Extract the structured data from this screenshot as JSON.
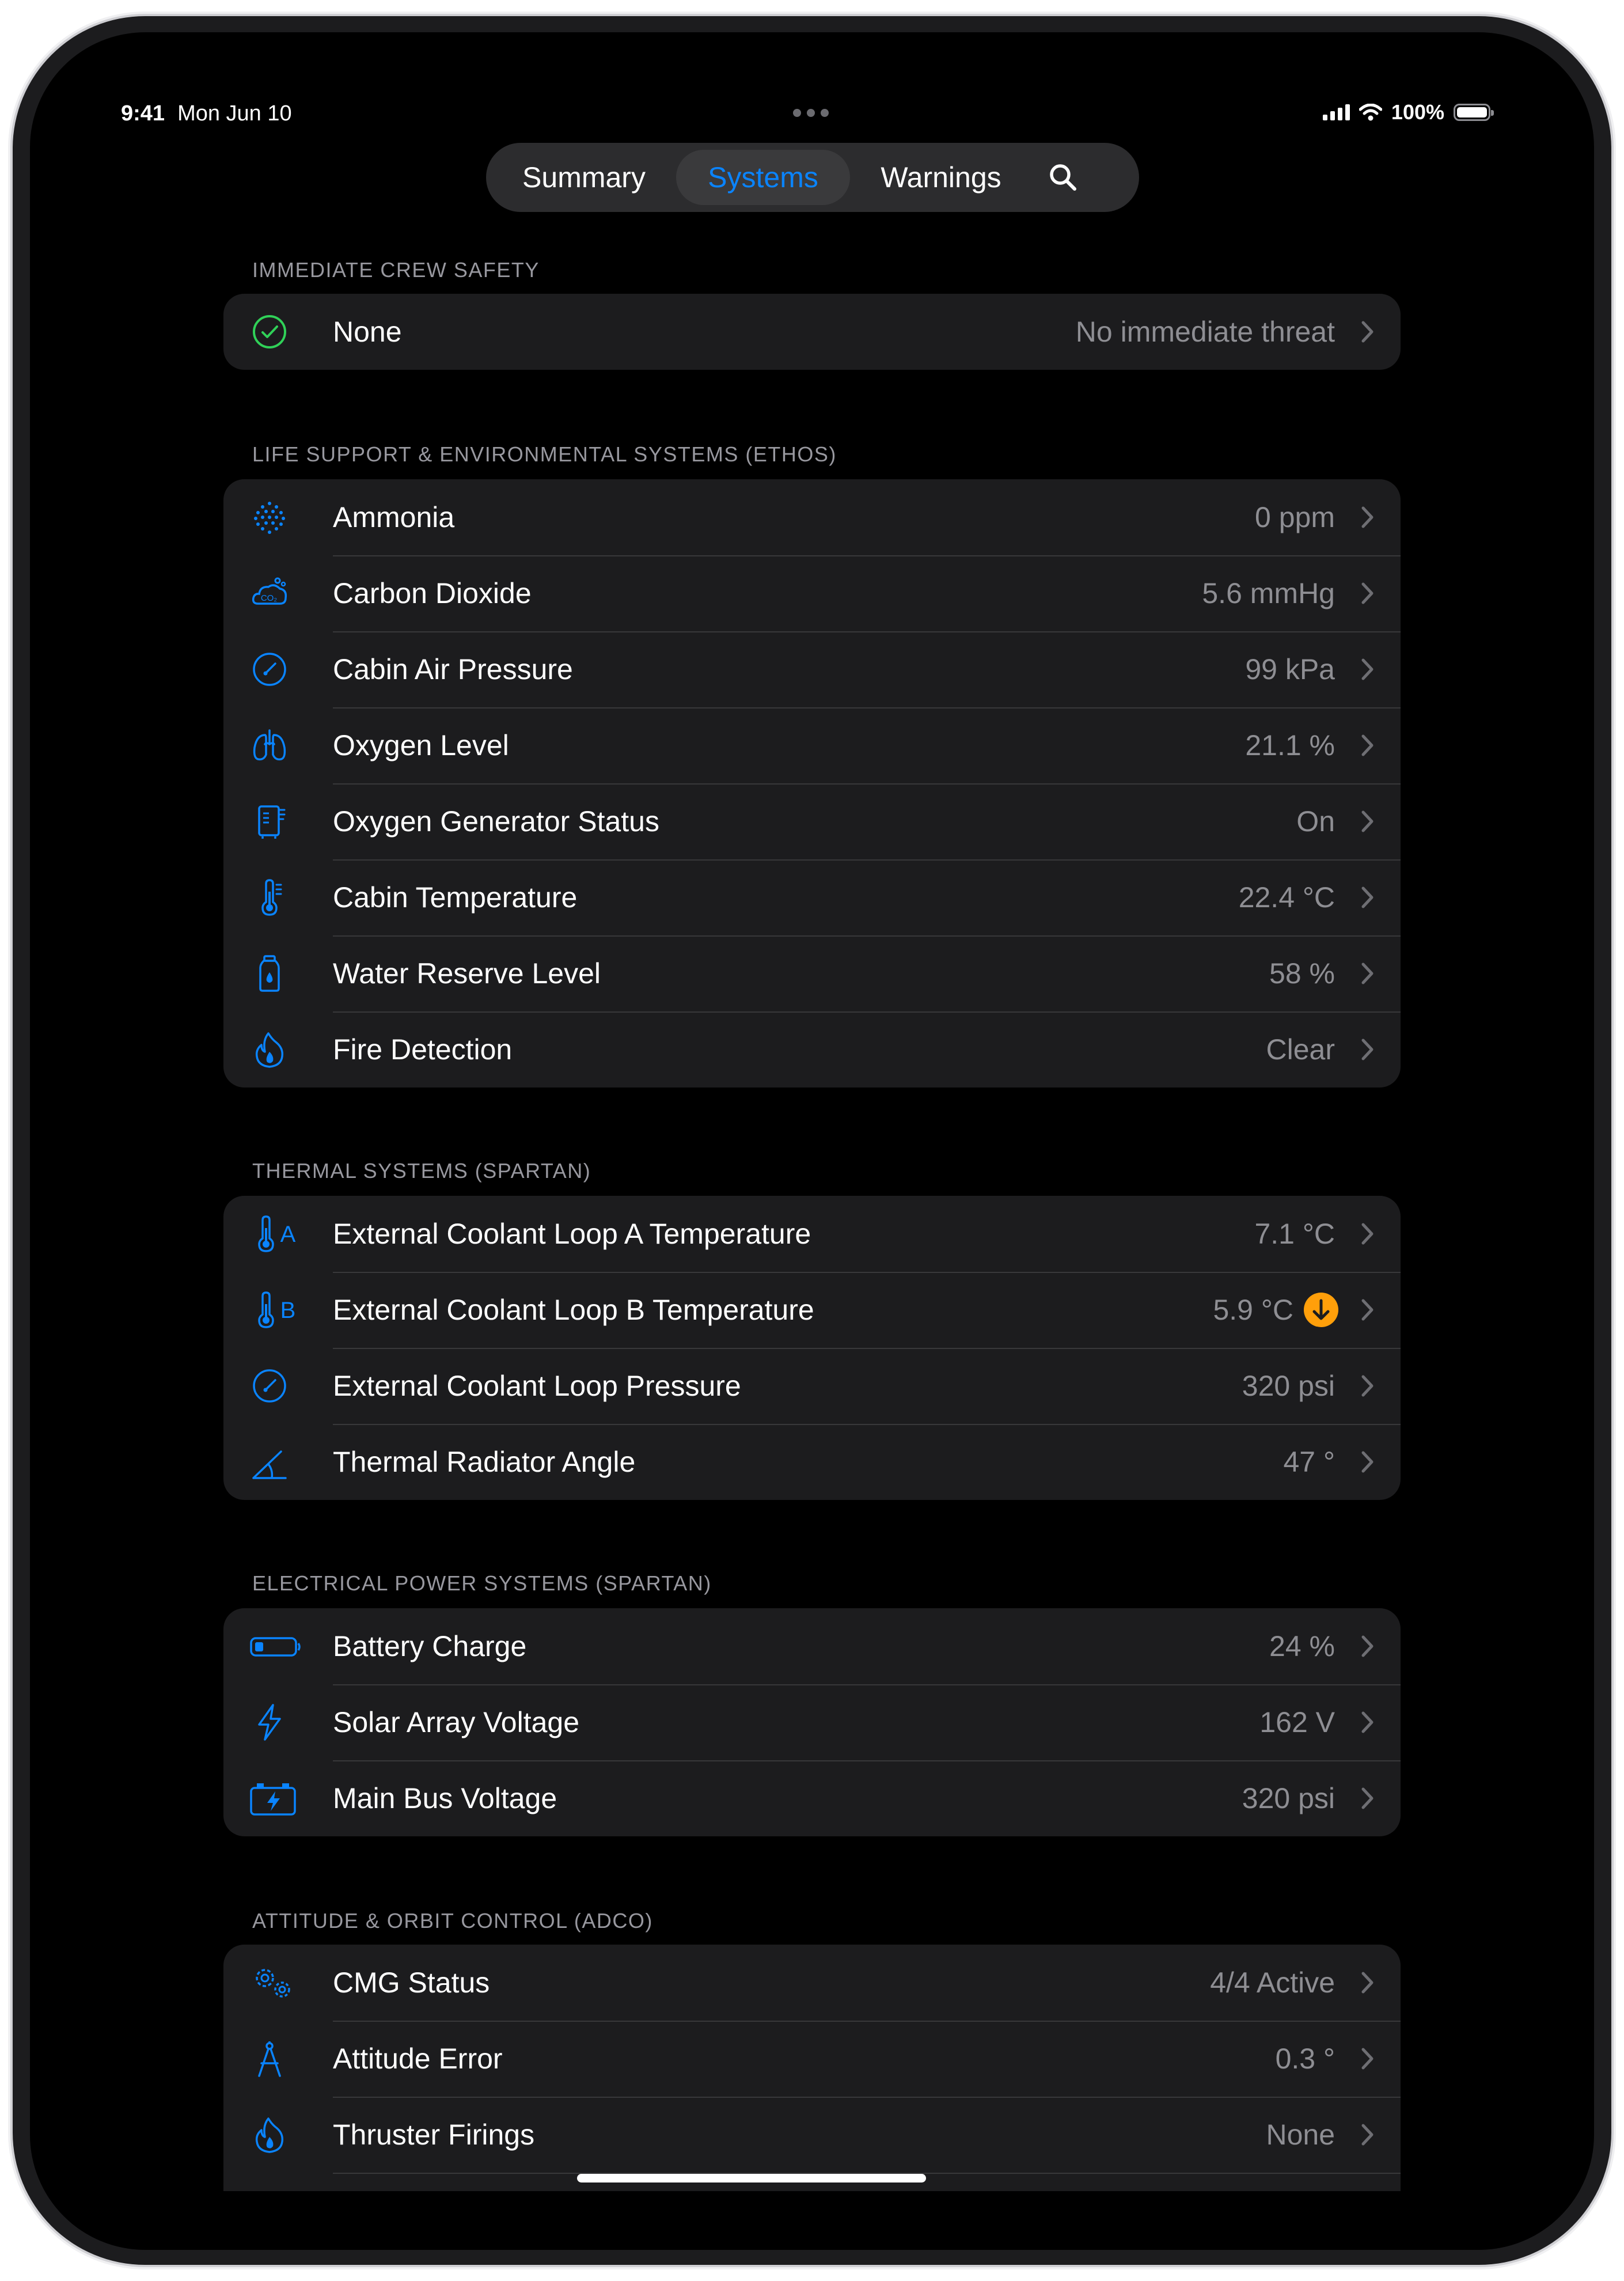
{
  "status": {
    "time": "9:41",
    "date": "Mon Jun 10",
    "battery": "100%"
  },
  "nav": {
    "tabs": [
      {
        "label": "Summary"
      },
      {
        "label": "Systems"
      },
      {
        "label": "Warnings"
      }
    ],
    "active_tab": "Systems",
    "search_icon": "search-icon"
  },
  "colors": {
    "accent": "#0a84ff",
    "safe": "#30d158",
    "warning": "#ff9f0a",
    "background": "#000000",
    "cell": "#1c1c1e"
  },
  "sections": {
    "safety": {
      "header": "IMMEDIATE CREW SAFETY",
      "rows": [
        {
          "label": "None",
          "value": "No immediate threat",
          "icon": "checkmark-circle-icon"
        }
      ]
    },
    "life_support": {
      "header": "LIFE SUPPORT & ENVIRONMENTAL SYSTEMS (ETHOS)",
      "rows": [
        {
          "label": "Ammonia",
          "value": "0 ppm",
          "icon": "dots-grid-icon"
        },
        {
          "label": "Carbon Dioxide",
          "value": "5.6 mmHg",
          "icon": "co2-cloud-icon"
        },
        {
          "label": "Cabin Air Pressure",
          "value": "99 kPa",
          "icon": "gauge-icon"
        },
        {
          "label": "Oxygen Level",
          "value": "21.1 %",
          "icon": "lungs-icon"
        },
        {
          "label": "Oxygen Generator Status",
          "value": "On",
          "icon": "generator-icon"
        },
        {
          "label": "Cabin Temperature",
          "value": "22.4 °C",
          "icon": "thermometer-icon"
        },
        {
          "label": "Water Reserve Level",
          "value": "58 %",
          "icon": "water-bottle-icon"
        },
        {
          "label": "Fire Detection",
          "value": "Clear",
          "icon": "flame-icon"
        }
      ]
    },
    "thermal": {
      "header": "THERMAL SYSTEMS (SPARTAN)",
      "rows": [
        {
          "label": "External Coolant Loop A Temperature",
          "value": "7.1 °C",
          "icon": "thermometer-a-icon"
        },
        {
          "label": "External Coolant Loop B Temperature",
          "value": "5.9 °C",
          "icon": "thermometer-b-icon",
          "alert": "down-arrow-warning-icon"
        },
        {
          "label": "External Coolant Loop Pressure",
          "value": "320 psi",
          "icon": "gauge-icon"
        },
        {
          "label": "Thermal Radiator Angle",
          "value": "47 °",
          "icon": "angle-icon"
        }
      ]
    },
    "electrical": {
      "header": "ELECTRICAL POWER SYSTEMS (SPARTAN)",
      "rows": [
        {
          "label": "Battery Charge",
          "value": "24 %",
          "icon": "battery-icon"
        },
        {
          "label": "Solar Array Voltage",
          "value": "162 V",
          "icon": "bolt-icon"
        },
        {
          "label": "Main Bus Voltage",
          "value": "320 psi",
          "icon": "car-battery-icon"
        }
      ]
    },
    "adco": {
      "header": "ATTITUDE & ORBIT CONTROL (ADCO)",
      "rows": [
        {
          "label": "CMG Status",
          "value": "4/4 Active",
          "icon": "gears-icon"
        },
        {
          "label": "Attitude Error",
          "value": "0.3 °",
          "icon": "compass-drawing-icon"
        },
        {
          "label": "Thruster Firings",
          "value": "None",
          "icon": "flame-icon"
        }
      ]
    }
  }
}
